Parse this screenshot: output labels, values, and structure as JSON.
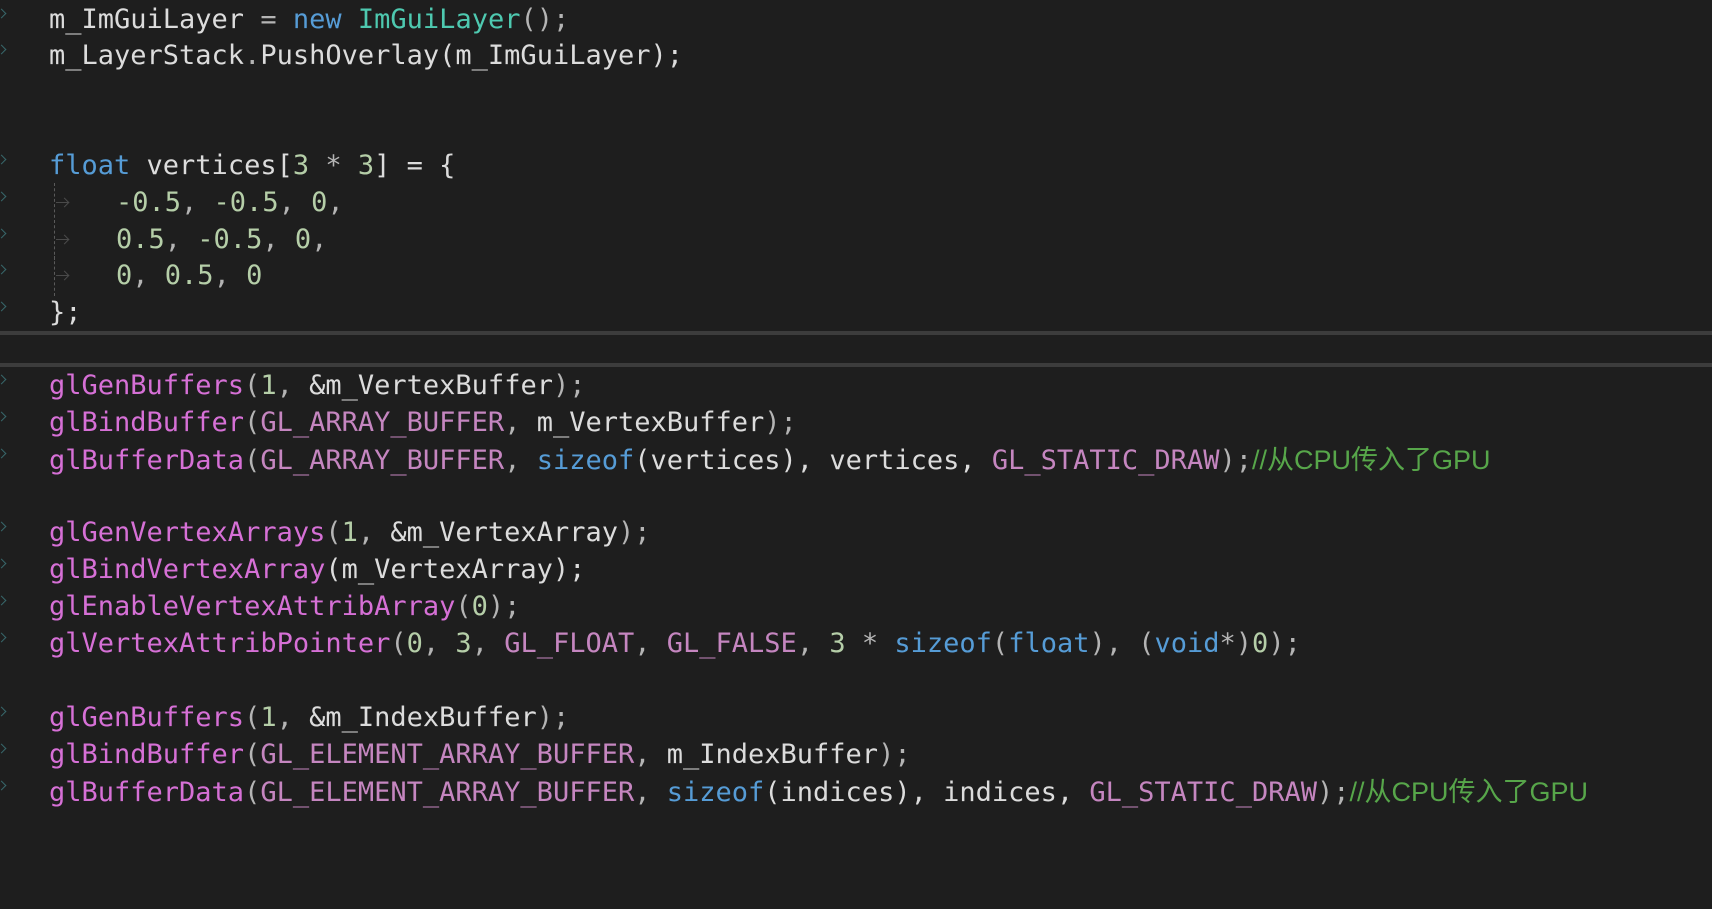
{
  "editor": {
    "lines": [
      {
        "tokens": [
          [
            "m_ImGuiLayer",
            "id"
          ],
          [
            " = ",
            "op"
          ],
          [
            "new",
            "kw"
          ],
          [
            " ",
            "op"
          ],
          [
            "ImGuiLayer",
            "type"
          ],
          [
            "();",
            "op"
          ]
        ]
      },
      {
        "tokens": [
          [
            "m_LayerStack",
            "id"
          ],
          [
            ".",
            "op"
          ],
          [
            "PushOverlay",
            "id"
          ],
          [
            "(m_ImGuiLayer);",
            "id"
          ]
        ]
      },
      {
        "tokens": []
      },
      {
        "tokens": []
      },
      {
        "tokens": [
          [
            "float",
            "kw"
          ],
          [
            " vertices[",
            "id"
          ],
          [
            "3",
            "num"
          ],
          [
            " * ",
            "op"
          ],
          [
            "3",
            "num"
          ],
          [
            "] = {",
            "id"
          ]
        ]
      },
      {
        "indent": true,
        "tokens": [
          [
            "-0.5",
            "num"
          ],
          [
            ", ",
            "op"
          ],
          [
            "-0.5",
            "num"
          ],
          [
            ", ",
            "op"
          ],
          [
            "0",
            "num"
          ],
          [
            ",",
            "op"
          ]
        ]
      },
      {
        "indent": true,
        "tokens": [
          [
            "0.5",
            "num"
          ],
          [
            ", ",
            "op"
          ],
          [
            "-0.5",
            "num"
          ],
          [
            ", ",
            "op"
          ],
          [
            "0",
            "num"
          ],
          [
            ",",
            "op"
          ]
        ]
      },
      {
        "indent": true,
        "tokens": [
          [
            "0",
            "num"
          ],
          [
            ", ",
            "op"
          ],
          [
            "0.5",
            "num"
          ],
          [
            ", ",
            "op"
          ],
          [
            "0",
            "num"
          ]
        ]
      },
      {
        "tokens": [
          [
            "};",
            "id"
          ]
        ]
      },
      {
        "tokens": [
          [
            "glGenBuffers",
            "fn"
          ],
          [
            "(",
            "op"
          ],
          [
            "1",
            "num"
          ],
          [
            ", ",
            "op"
          ],
          [
            "&m_VertexBuffer",
            "id"
          ],
          [
            ");",
            "op"
          ]
        ]
      },
      {
        "tokens": [
          [
            "glBindBuffer",
            "fn"
          ],
          [
            "(",
            "op"
          ],
          [
            "GL_ARRAY_BUFFER",
            "mac"
          ],
          [
            ", ",
            "op"
          ],
          [
            "m_VertexBuffer",
            "id"
          ],
          [
            ");",
            "op"
          ]
        ]
      },
      {
        "tokens": [
          [
            "glBufferData",
            "fn"
          ],
          [
            "(",
            "op"
          ],
          [
            "GL_ARRAY_BUFFER",
            "mac"
          ],
          [
            ", ",
            "op"
          ],
          [
            "sizeof",
            "kw"
          ],
          [
            "(vertices), vertices, ",
            "id"
          ],
          [
            "GL_STATIC_DRAW",
            "mac"
          ],
          [
            ");",
            "op"
          ],
          [
            "//从CPU传入了GPU",
            "cm"
          ]
        ]
      },
      {
        "tokens": []
      },
      {
        "tokens": [
          [
            "glGenVertexArrays",
            "fn"
          ],
          [
            "(",
            "op"
          ],
          [
            "1",
            "num"
          ],
          [
            ", ",
            "op"
          ],
          [
            "&m_VertexArray",
            "id"
          ],
          [
            ");",
            "op"
          ]
        ]
      },
      {
        "tokens": [
          [
            "glBindVertexArray",
            "fn"
          ],
          [
            "(m_VertexArray);",
            "id"
          ]
        ]
      },
      {
        "tokens": [
          [
            "glEnableVertexAttribArray",
            "fn"
          ],
          [
            "(",
            "op"
          ],
          [
            "0",
            "num"
          ],
          [
            ");",
            "op"
          ]
        ]
      },
      {
        "tokens": [
          [
            "glVertexAttribPointer",
            "fn"
          ],
          [
            "(",
            "op"
          ],
          [
            "0",
            "num"
          ],
          [
            ", ",
            "op"
          ],
          [
            "3",
            "num"
          ],
          [
            ", ",
            "op"
          ],
          [
            "GL_FLOAT",
            "mac"
          ],
          [
            ", ",
            "op"
          ],
          [
            "GL_FALSE",
            "mac"
          ],
          [
            ", ",
            "op"
          ],
          [
            "3",
            "num"
          ],
          [
            " * ",
            "op"
          ],
          [
            "sizeof",
            "kw"
          ],
          [
            "(",
            "op"
          ],
          [
            "float",
            "kw"
          ],
          [
            "), (",
            "op"
          ],
          [
            "void",
            "kw"
          ],
          [
            "*)",
            "op"
          ],
          [
            "0",
            "num"
          ],
          [
            ");",
            "op"
          ]
        ]
      },
      {
        "tokens": []
      },
      {
        "tokens": [
          [
            "glGenBuffers",
            "fn"
          ],
          [
            "(",
            "op"
          ],
          [
            "1",
            "num"
          ],
          [
            ", ",
            "op"
          ],
          [
            "&m_IndexBuffer",
            "id"
          ],
          [
            ");",
            "op"
          ]
        ]
      },
      {
        "tokens": [
          [
            "glBindBuffer",
            "fn"
          ],
          [
            "(",
            "op"
          ],
          [
            "GL_ELEMENT_ARRAY_BUFFER",
            "mac"
          ],
          [
            ", ",
            "op"
          ],
          [
            "m_IndexBuffer",
            "id"
          ],
          [
            ");",
            "op"
          ]
        ]
      },
      {
        "tokens": [
          [
            "glBufferData",
            "fn"
          ],
          [
            "(",
            "op"
          ],
          [
            "GL_ELEMENT_ARRAY_BUFFER",
            "mac"
          ],
          [
            ", ",
            "op"
          ],
          [
            "sizeof",
            "kw"
          ],
          [
            "(indices), indices, ",
            "id"
          ],
          [
            "GL_STATIC_DRAW",
            "mac"
          ],
          [
            ");",
            "op"
          ],
          [
            "//从CPU传入了GPU",
            "cm"
          ]
        ]
      }
    ]
  },
  "colors": {
    "background": "#1e1e1e",
    "function": "#d670d6",
    "keyword": "#569cd6",
    "type": "#4ec9b0",
    "number": "#b5cea8",
    "macro": "#c586c0",
    "comment": "#57a64a",
    "identifier": "#dcdcdc"
  }
}
